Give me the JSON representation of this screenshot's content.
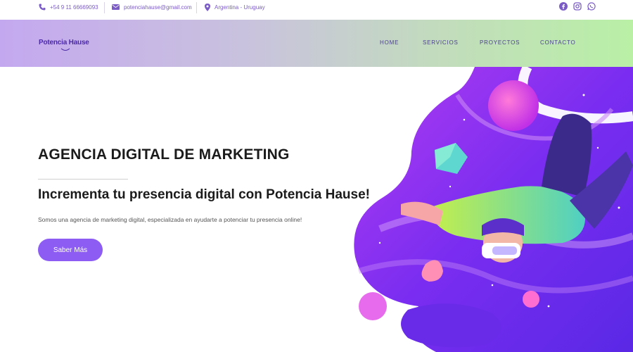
{
  "topbar": {
    "phone": "+54 9 11 66669093",
    "email": "potenciahause@gmail.com",
    "location": "Argentina - Uruguay",
    "icons": [
      "phone-icon",
      "mail-icon",
      "location-pin-icon",
      "facebook-icon",
      "instagram-icon",
      "whatsapp-icon"
    ]
  },
  "header": {
    "logo": "Potencia Hause",
    "nav": [
      "HOME",
      "SERVICIOS",
      "PROYECTOS",
      "CONTACTO"
    ]
  },
  "hero": {
    "title": "AGENCIA DIGITAL DE MARKETING",
    "subtitle": "Incrementa tu presencia digital con Potencia Hause!",
    "description": "Somos una agencia de marketing digital, especializada en ayudarte a potenciar tu presencia online!",
    "cta_label": "Saber Más"
  },
  "colors": {
    "accent": "#8c5cf3",
    "icon": "#7b5cc7",
    "header_left": "#c4a8ef",
    "header_right": "#b9f0a6"
  }
}
